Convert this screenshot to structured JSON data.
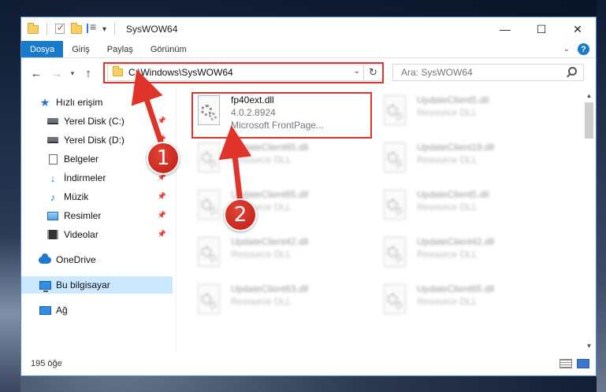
{
  "window": {
    "title": "SysWOW64"
  },
  "ribbon": {
    "tabs": [
      "Dosya",
      "Giriş",
      "Paylaş",
      "Görünüm"
    ],
    "help": "?"
  },
  "navbar": {
    "back": "←",
    "forward": "→",
    "recent": "▾",
    "up": "↑"
  },
  "address": {
    "path": "C:\\Windows\\SysWOW64"
  },
  "search": {
    "placeholder": "Ara: SysWOW64"
  },
  "sidebar": {
    "items": [
      {
        "label": "Hızlı erişim",
        "icon": "star-icon"
      },
      {
        "label": "Yerel Disk (C:)",
        "icon": "drive-icon"
      },
      {
        "label": "Yerel Disk (D:)",
        "icon": "drive-icon"
      },
      {
        "label": "Belgeler",
        "icon": "documents-icon"
      },
      {
        "label": "İndirmeler",
        "icon": "downloads-icon"
      },
      {
        "label": "Müzik",
        "icon": "music-icon"
      },
      {
        "label": "Resimler",
        "icon": "pictures-icon"
      },
      {
        "label": "Videolar",
        "icon": "videos-icon"
      },
      {
        "label": "OneDrive",
        "icon": "onedrive-icon"
      },
      {
        "label": "Bu bilgisayar",
        "icon": "computer-icon"
      },
      {
        "label": "Ağ",
        "icon": "network-icon"
      }
    ]
  },
  "files": [
    {
      "name": "fp40ext.dll",
      "line2": "4.0.2.8924",
      "line3": "Microsoft FrontPage..."
    },
    {
      "name": "UpdateClient5.dll",
      "line2": "Resource DLL"
    },
    {
      "name": "UpdateClient65.dll",
      "line2": "Resource DLL"
    },
    {
      "name": "UpdateClient19.dll",
      "line2": "Resource DLL"
    },
    {
      "name": "UpdateClient65.dll",
      "line2": "Resource DLL"
    },
    {
      "name": "UpdateClient5.dll",
      "line2": "Resource DLL"
    },
    {
      "name": "UpdateClient42.dll",
      "line2": "Resource DLL"
    },
    {
      "name": "UpdateClient42.dll",
      "line2": "Resource DLL"
    },
    {
      "name": "UpdateClient63.dll",
      "line2": "Resource DLL"
    },
    {
      "name": "UpdateClient65.dll",
      "line2": "Resource DLL"
    }
  ],
  "status": {
    "count": "195 öğe"
  },
  "annotations": {
    "step1": "1",
    "step2": "2",
    "color": "#e0342b"
  }
}
